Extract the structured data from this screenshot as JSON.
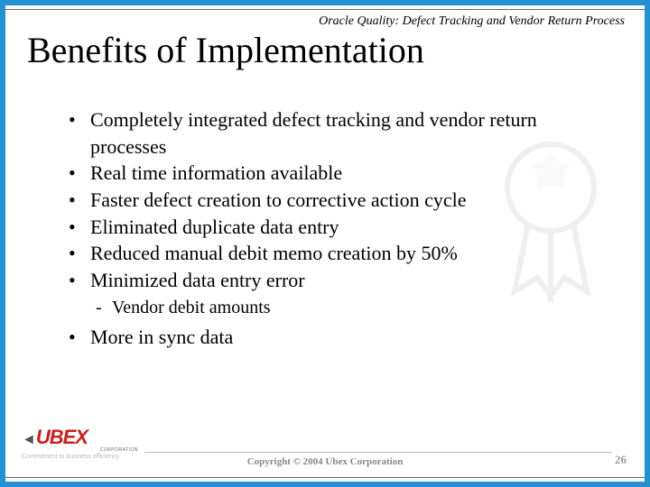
{
  "header": {
    "small_title": "Oracle Quality: Defect Tracking and Vendor Return Process"
  },
  "title": "Benefits of Implementation",
  "bullets": [
    "Completely integrated defect tracking and vendor return processes",
    "Real time information available",
    "Faster defect creation to corrective action cycle",
    "Eliminated duplicate data entry",
    "Reduced manual debit memo creation by 50%",
    "Minimized data entry error"
  ],
  "sub_bullets": [
    "Vendor debit amounts"
  ],
  "bullets_after": [
    "More in sync data"
  ],
  "footer": {
    "logo_text": "UBEX",
    "logo_corp": "CORPORATION",
    "logo_tagline": "Commitment to business efficiency",
    "copyright": "Copyright © 2004 Ubex Corporation",
    "page": "26"
  }
}
